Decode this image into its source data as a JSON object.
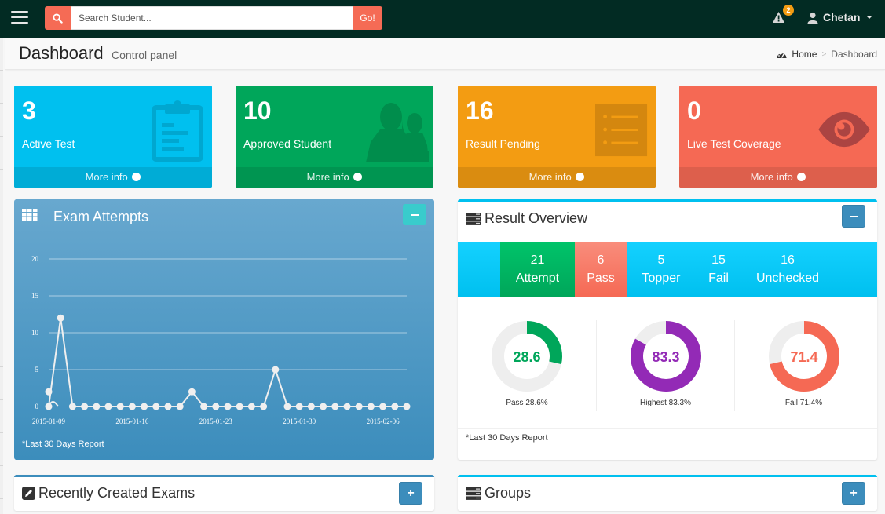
{
  "topbar": {
    "search_placeholder": "Search Student...",
    "go_label": "Go!",
    "alert_count": "2",
    "user_name": "Chetan"
  },
  "header": {
    "title": "Dashboard",
    "subtitle": "Control panel",
    "breadcrumb": [
      "Home",
      "Dashboard"
    ]
  },
  "stat_boxes": [
    {
      "value": "3",
      "label": "Active Test",
      "footer": "More info",
      "color": "#00c0ef",
      "footer_color": "#00acd6",
      "icon": "clipboard-icon"
    },
    {
      "value": "10",
      "label": "Approved Student",
      "footer": "More info",
      "color": "#00a65a",
      "footer_color": "#009551",
      "icon": "users-icon"
    },
    {
      "value": "16",
      "label": "Result Pending",
      "footer": "More info",
      "color": "#f39c12",
      "footer_color": "#da8c10",
      "icon": "list-icon"
    },
    {
      "value": "0",
      "label": "Live Test Coverage",
      "footer": "More info",
      "color": "#f56954",
      "footer_color": "#dd5f4c",
      "icon": "eye-icon"
    }
  ],
  "exam_attempts": {
    "title": "Exam Attempts",
    "footer": "*Last 30 Days Report"
  },
  "result_overview": {
    "title": "Result Overview",
    "stats": [
      {
        "value": "21",
        "label": "Attempt",
        "bg": "#00a65a"
      },
      {
        "value": "6",
        "label": "Pass",
        "bg": "#f56954"
      },
      {
        "value": "5",
        "label": "Topper",
        "bg": ""
      },
      {
        "value": "15",
        "label": "Fail",
        "bg": ""
      },
      {
        "value": "16",
        "label": "Unchecked",
        "bg": ""
      }
    ],
    "donuts": [
      {
        "value": 28.6,
        "display": "28.6",
        "caption": "Pass 28.6%",
        "color": "#00a65a"
      },
      {
        "value": 83.3,
        "display": "83.3",
        "caption": "Highest 83.3%",
        "color": "#932ab6"
      },
      {
        "value": 71.4,
        "display": "71.4",
        "caption": "Fail 71.4%",
        "color": "#f56954"
      }
    ],
    "footer": "*Last 30 Days Report"
  },
  "bottom_boxes": {
    "recent_exams_title": "Recently Created Exams",
    "groups_title": "Groups"
  },
  "chart_data": {
    "type": "line",
    "title": "Exam Attempts",
    "xlabel": "",
    "ylabel": "",
    "ylim": [
      0,
      20
    ],
    "yticks": [
      0,
      5,
      10,
      15,
      20
    ],
    "xtick_labels": [
      "2015-01-09",
      "2015-01-16",
      "2015-01-23",
      "2015-01-30",
      "2015-02-06"
    ],
    "grid": true,
    "x": [
      "2015-01-09",
      "2015-01-10",
      "2015-01-11",
      "2015-01-12",
      "2015-01-13",
      "2015-01-14",
      "2015-01-15",
      "2015-01-16",
      "2015-01-17",
      "2015-01-18",
      "2015-01-19",
      "2015-01-20",
      "2015-01-21",
      "2015-01-22",
      "2015-01-23",
      "2015-01-24",
      "2015-01-25",
      "2015-01-26",
      "2015-01-27",
      "2015-01-28",
      "2015-01-29",
      "2015-01-30",
      "2015-01-31",
      "2015-02-01",
      "2015-02-02",
      "2015-02-03",
      "2015-02-04",
      "2015-02-05",
      "2015-02-06",
      "2015-02-07",
      "2015-02-08"
    ],
    "values": [
      0,
      12,
      0,
      0,
      0,
      0,
      0,
      0,
      0,
      0,
      0,
      0,
      2,
      0,
      0,
      0,
      0,
      0,
      0,
      5,
      0,
      0,
      0,
      0,
      0,
      0,
      0,
      0,
      0,
      0,
      0
    ],
    "extra_points": [
      {
        "x": "2015-01-09",
        "y": 2
      }
    ],
    "line_color": "#efefef"
  }
}
